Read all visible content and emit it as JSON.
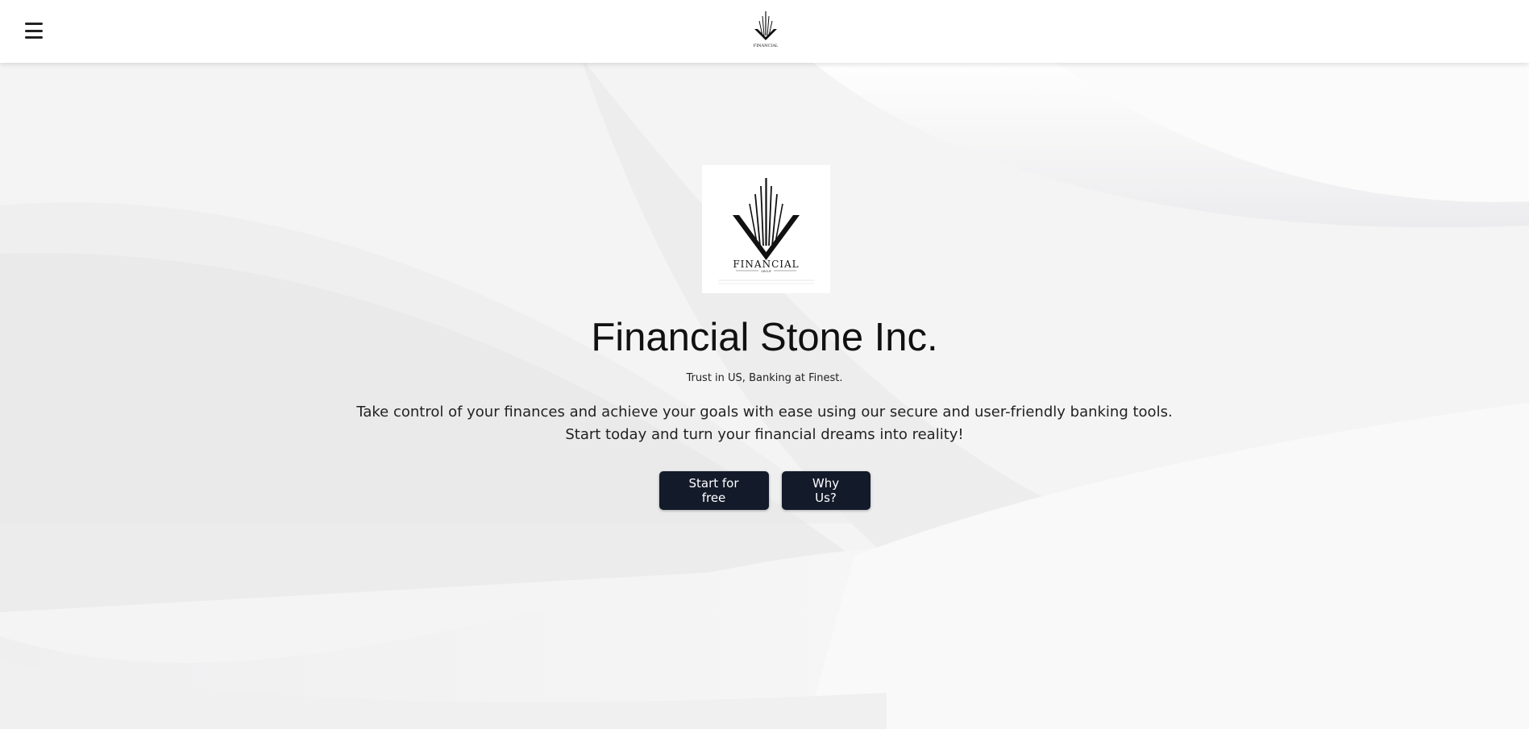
{
  "header": {
    "menu_icon": "hamburger-menu-icon",
    "logo_text": "FINANCIAL"
  },
  "hero": {
    "logo_text": "FINANCIAL",
    "logo_subtext": "GROUP",
    "title": "Financial Stone Inc.",
    "tagline": "Trust in US, Banking at Finest.",
    "description_line1": "Take control of your finances and achieve your goals with ease using our secure and user-friendly banking tools.",
    "description_line2": "Start today and turn your financial dreams into reality!",
    "primary_button": "Start for free",
    "secondary_button": "Why Us?"
  },
  "colors": {
    "button_bg": "#131a2a",
    "background": "#f3f3f4",
    "header_bg": "#ffffff"
  }
}
